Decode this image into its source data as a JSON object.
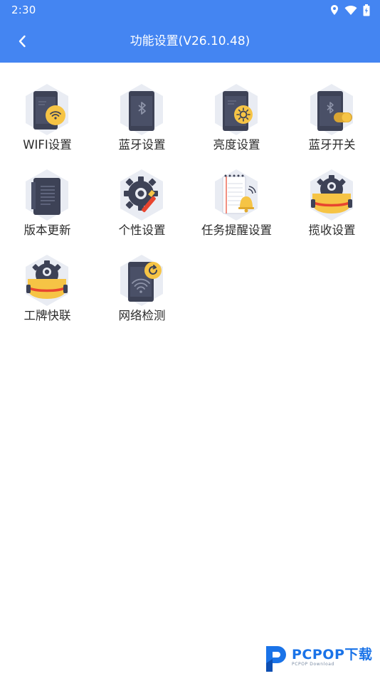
{
  "status_bar": {
    "time": "2:30"
  },
  "header": {
    "title": "功能设置(V26.10.48)"
  },
  "tiles": [
    {
      "label": "WIFI设置"
    },
    {
      "label": "蓝牙设置"
    },
    {
      "label": "亮度设置"
    },
    {
      "label": "蓝牙开关"
    },
    {
      "label": "版本更新"
    },
    {
      "label": "个性设置"
    },
    {
      "label": "任务提醒设置"
    },
    {
      "label": "揽收设置"
    },
    {
      "label": "工牌快联"
    },
    {
      "label": "网络检测"
    }
  ],
  "watermark": {
    "brand": "PCPOP下载",
    "sub": "PCPOP Download"
  },
  "colors": {
    "header_bg": "#4485f2",
    "accent_yellow": "#f6c445",
    "device_dark": "#3d4256",
    "hex_bg": "#e9ecf3"
  }
}
